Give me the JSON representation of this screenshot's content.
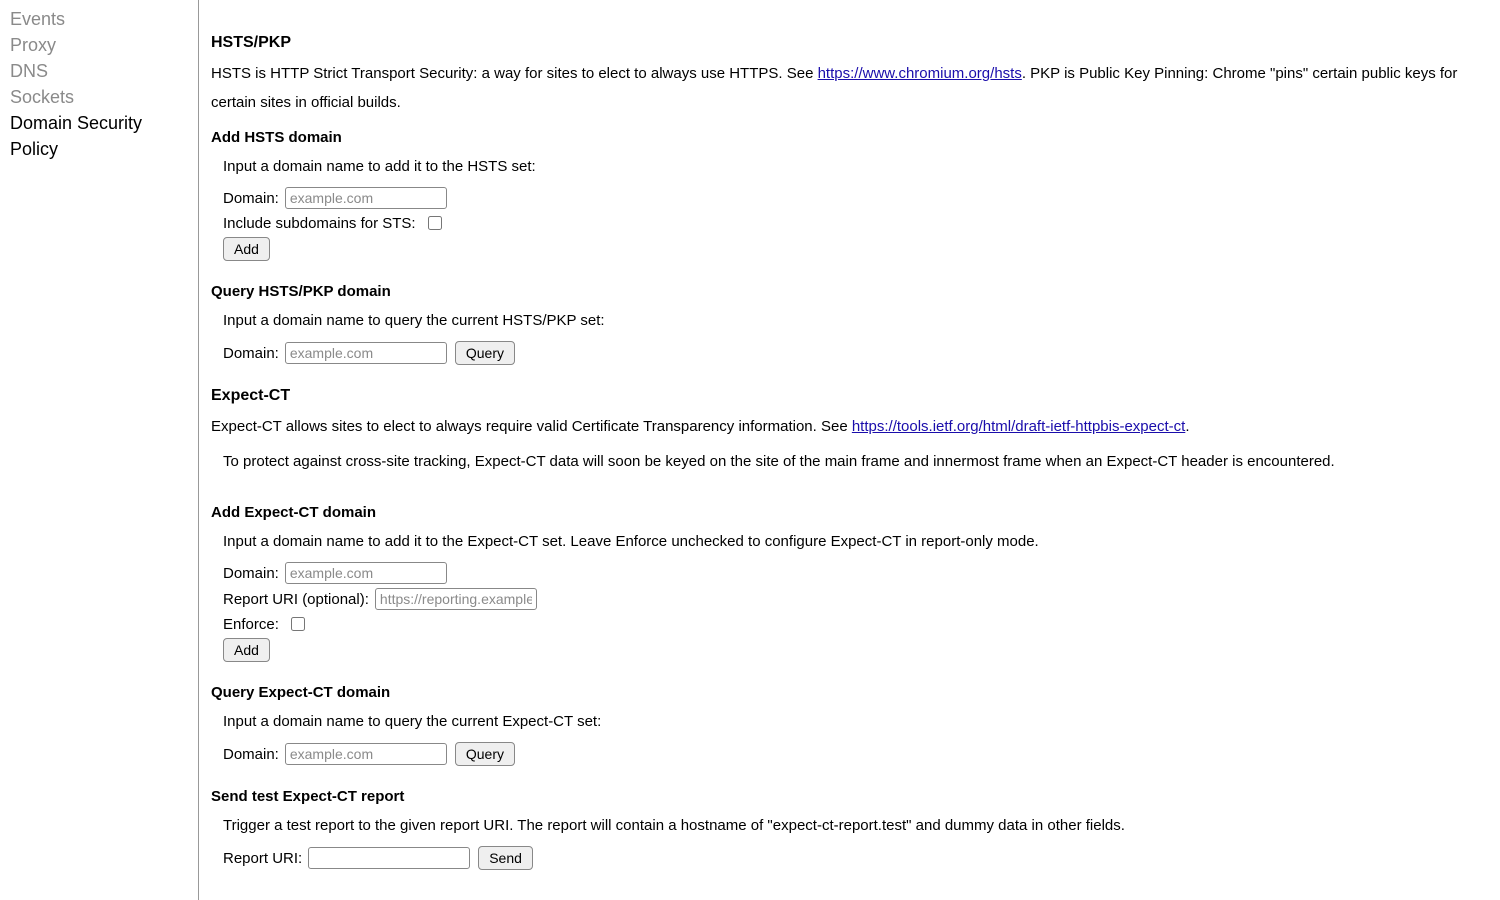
{
  "sidebar": {
    "items": [
      {
        "label": "Events"
      },
      {
        "label": "Proxy"
      },
      {
        "label": "DNS"
      },
      {
        "label": "Sockets"
      },
      {
        "label": "Domain Security Policy"
      }
    ]
  },
  "hsts": {
    "heading": "HSTS/PKP",
    "intro_pre": "HSTS is HTTP Strict Transport Security: a way for sites to elect to always use HTTPS. See ",
    "intro_link": "https://www.chromium.org/hsts",
    "intro_post": ". PKP is Public Key Pinning: Chrome \"pins\" certain public keys for certain sites in official builds.",
    "add": {
      "heading": "Add HSTS domain",
      "instruction": "Input a domain name to add it to the HSTS set:",
      "domain_label": "Domain:",
      "domain_placeholder": "example.com",
      "include_label": "Include subdomains for STS:",
      "add_button": "Add"
    },
    "query": {
      "heading": "Query HSTS/PKP domain",
      "instruction": "Input a domain name to query the current HSTS/PKP set:",
      "domain_label": "Domain:",
      "domain_placeholder": "example.com",
      "query_button": "Query"
    }
  },
  "expect_ct": {
    "heading": "Expect-CT",
    "intro_pre": "Expect-CT allows sites to elect to always require valid Certificate Transparency information. See ",
    "intro_link": "https://tools.ietf.org/html/draft-ietf-httpbis-expect-ct",
    "intro_post": ".",
    "note": "To protect against cross-site tracking, Expect-CT data will soon be keyed on the site of the main frame and innermost frame when an Expect-CT header is encountered.",
    "add": {
      "heading": "Add Expect-CT domain",
      "instruction": "Input a domain name to add it to the Expect-CT set. Leave Enforce unchecked to configure Expect-CT in report-only mode.",
      "domain_label": "Domain:",
      "domain_placeholder": "example.com",
      "report_label": "Report URI (optional):",
      "report_placeholder": "https://reporting.example",
      "enforce_label": "Enforce:",
      "add_button": "Add"
    },
    "query": {
      "heading": "Query Expect-CT domain",
      "instruction": "Input a domain name to query the current Expect-CT set:",
      "domain_label": "Domain:",
      "domain_placeholder": "example.com",
      "query_button": "Query"
    },
    "test": {
      "heading": "Send test Expect-CT report",
      "instruction": "Trigger a test report to the given report URI. The report will contain a hostname of \"expect-ct-report.test\" and dummy data in other fields.",
      "report_label": "Report URI:",
      "send_button": "Send"
    }
  }
}
